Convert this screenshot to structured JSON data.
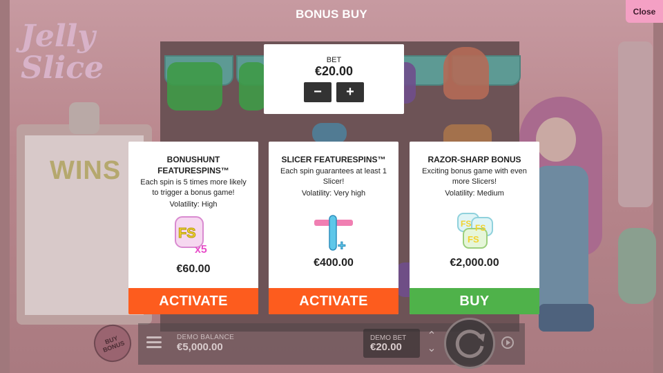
{
  "overlay": {
    "title": "BONUS BUY",
    "close_label": "Close"
  },
  "bet": {
    "label": "BET",
    "value": "€20.00",
    "minus_label": "−",
    "plus_label": "+"
  },
  "cards": [
    {
      "title": "BONUSHUNT FEATURESPINS™",
      "description": "Each spin is 5 times more likely to trigger a bonus game!",
      "volatility": "Volatility: High",
      "icon": "fs-x5-icon",
      "price": "€60.00",
      "action_label": "ACTIVATE",
      "action_color": "#fd5c1e"
    },
    {
      "title": "SLICER FEATURESPINS™",
      "description": "Each spin guarantees at least 1 Slicer!",
      "volatility": "Volatility: Very high",
      "icon": "slicer-plus-icon",
      "price": "€400.00",
      "action_label": "ACTIVATE",
      "action_color": "#fd5c1e"
    },
    {
      "title": "RAZOR-SHARP BONUS",
      "description": "Exciting bonus game with even more Slicers!",
      "volatility": "Volatility: Medium",
      "icon": "fs-stack-icon",
      "price": "€2,000.00",
      "action_label": "BUY",
      "action_color": "#4fb24a"
    }
  ],
  "game": {
    "logo_text": "Jelly Slice",
    "wins_label": "WINS",
    "buy_bonus_label": "BUY BONUS",
    "demo_balance_label": "DEMO BALANCE",
    "demo_balance_value": "€5,000.00",
    "demo_bet_label": "DEMO BET",
    "demo_bet_value": "€20.00"
  }
}
